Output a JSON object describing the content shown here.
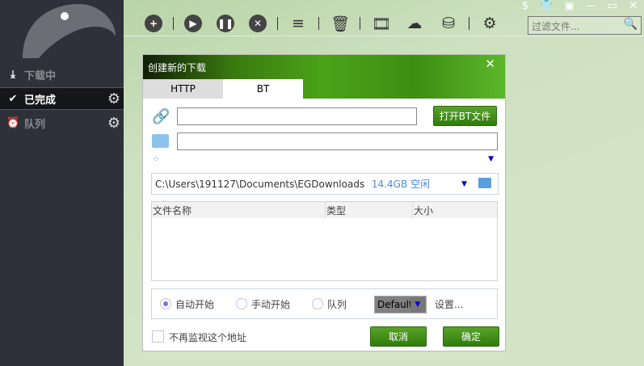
{
  "sidebar": {
    "items": [
      {
        "label": "下载中",
        "icon": "download-icon"
      },
      {
        "label": "已完成",
        "icon": "check-circle-icon"
      },
      {
        "label": "队列",
        "icon": "alarm-clock-icon"
      }
    ]
  },
  "toolbar": {
    "filter_placeholder": "过滤文件..."
  },
  "dialog": {
    "title": "创建新的下载",
    "tabs": [
      "HTTP",
      "BT"
    ],
    "open_bt_label": "打开BT文件",
    "path": "C:\\Users\\191127\\Documents\\EGDownloads",
    "free_space": "14.4GB 空闲",
    "columns": [
      "文件名称",
      "类型",
      "大小"
    ],
    "options": {
      "auto": "自动开始",
      "manual": "手动开始",
      "queue": "队列",
      "queue_select": "Default",
      "settings": "设置..."
    },
    "no_monitor": "不再监视这个地址",
    "cancel": "取消",
    "ok": "确定"
  }
}
